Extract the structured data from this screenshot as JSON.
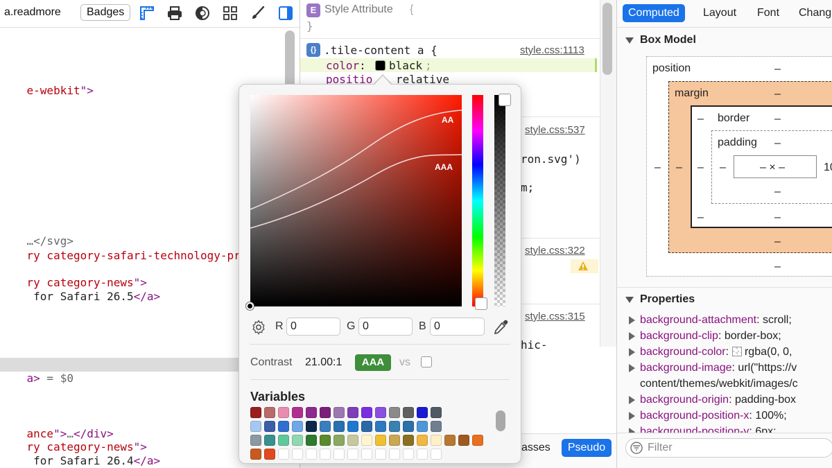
{
  "toolbar": {
    "breadcrumb": "a.readmore",
    "badges_label": "Badges",
    "icons": [
      "rulers-icon",
      "print-icon",
      "contrast-icon",
      "layout-grid-icon",
      "paintbrush-icon",
      "sidebar-toggle-icon"
    ]
  },
  "dom": {
    "lines": [
      {
        "parts": [
          {
            "c": "attr",
            "t": "e-webkit"
          },
          {
            "c": "tag",
            "t": "\">"
          }
        ]
      },
      {
        "parts": [
          {
            "c": "gray",
            "t": "…</svg>"
          }
        ]
      },
      {
        "parts": [
          {
            "c": "attr",
            "t": "ry category-safari-technology-prev"
          }
        ]
      },
      {
        "parts": [
          {
            "c": "attr",
            "t": "ry category-news"
          },
          {
            "c": "tag",
            "t": "\">"
          }
        ]
      },
      {
        "parts": [
          {
            "c": "txt",
            "t": " for Safari 26.5"
          },
          {
            "c": "tag",
            "t": "</a>"
          }
        ]
      },
      {
        "parts": [
          {
            "c": "tag",
            "t": "a>"
          },
          {
            "c": "gray",
            "t": " = $0"
          }
        ]
      },
      {
        "parts": [
          {
            "c": "attr",
            "t": "ance"
          },
          {
            "c": "tag",
            "t": "\">"
          },
          {
            "c": "gray",
            "t": "…"
          },
          {
            "c": "tag",
            "t": "</div>"
          }
        ]
      },
      {
        "parts": [
          {
            "c": "attr",
            "t": "ry category-news"
          },
          {
            "c": "tag",
            "t": "\">"
          }
        ]
      },
      {
        "parts": [
          {
            "c": "txt",
            "t": " for Safari 26.4"
          },
          {
            "c": "tag",
            "t": "</a>"
          }
        ]
      }
    ]
  },
  "styles": {
    "style_attribute": {
      "label": "Style Attribute",
      "open": "{",
      "close": "}"
    },
    "rule1": {
      "selector": ".tile-content a {",
      "source": "style.css:1113",
      "color_prop": "color",
      "color_value": "black",
      "position_prop": "positio",
      "position_value": "relative"
    },
    "rule2": {
      "source": "style.css:537",
      "fragment1": "ron.svg')",
      "fragment2": "m;"
    },
    "rule3": {
      "source": "style.css:322"
    },
    "rule4": {
      "source": "style.css:315",
      "fragment1": "hic-"
    },
    "classes_label": "asses",
    "pseudo_label": "Pseudo"
  },
  "sidebar": {
    "tabs": [
      {
        "label": "Computed",
        "active": true
      },
      {
        "label": "Layout",
        "active": false
      },
      {
        "label": "Font",
        "active": false
      },
      {
        "label": "Chang",
        "active": false
      }
    ],
    "box_model": {
      "title": "Box Model",
      "position_label": "position",
      "margin_label": "margin",
      "border_label": "border",
      "padding_label": "padding",
      "content_value": "– × –",
      "dash": "–",
      "right_value": "10",
      "margin_color": "#f6c69c"
    },
    "properties": {
      "title": "Properties",
      "rows": [
        {
          "name": "background-attachment",
          "value": "scroll;"
        },
        {
          "name": "background-clip",
          "value": "border-box;"
        },
        {
          "name": "background-color",
          "value": "rgba(0, 0,"
        },
        {
          "name": "background-image",
          "value": "url(\"https://v"
        },
        {
          "name": "",
          "value": "content/themes/webkit/images/c"
        },
        {
          "name": "background-origin",
          "value": "padding-box"
        },
        {
          "name": "background-position-x",
          "value": "100%;"
        },
        {
          "name": "background-position-y",
          "value": "6px;"
        }
      ]
    },
    "filter_placeholder": "Filter"
  },
  "picker": {
    "aa_label": "AA",
    "aaa_label": "AAA",
    "r_label": "R",
    "r_value": "0",
    "g_label": "G",
    "g_value": "0",
    "b_label": "B",
    "b_value": "0",
    "contrast_label": "Contrast",
    "contrast_value": "21.00:1",
    "contrast_badge": "AAA",
    "vs_label": "vs",
    "variables_title": "Variables",
    "swatch_rows": [
      [
        "#9b1d1d",
        "#b86b6b",
        "#e88db0",
        "#b0308f",
        "#8e2a8e",
        "#7a1f7a",
        "#9b78b2",
        "#7e3fb8",
        "#7b2ee0",
        "#8a4fe0",
        "#8a8a8a",
        "#606060",
        "#1a1ad0",
        "#505a66"
      ],
      [
        "#a6c8f0",
        "#3a5ea8",
        "#2f6fd0",
        "#6fa8e8",
        "#0b2a4a",
        "#3a7ec0",
        "#2a6fb0",
        "#1f78d0",
        "#2a68a8",
        "#2e78c0",
        "#3a80b0",
        "#2d6fa8",
        "#4f96d8",
        "#6f7f8f"
      ],
      [
        "#8a9aa0",
        "#3a8f8f",
        "#5fc89a",
        "#8fd8b0",
        "#2e7a2e",
        "#5a8a2a",
        "#8aa860",
        "#c8c8a0",
        "#fff6d0",
        "#f0c030",
        "#c8a850",
        "#8a7020",
        "#f0b840",
        "#fff0c8",
        "#b87830",
        "#a05a20",
        "#e87020"
      ],
      [
        "#c85a20",
        "#e04a20",
        "#ffffff",
        "#ffffff",
        "#ffffff",
        "#ffffff",
        "#ffffff",
        "#ffffff",
        "#ffffff",
        "#ffffff",
        "#ffffff",
        "#ffffff",
        "#ffffff",
        "#ffffff"
      ]
    ]
  }
}
